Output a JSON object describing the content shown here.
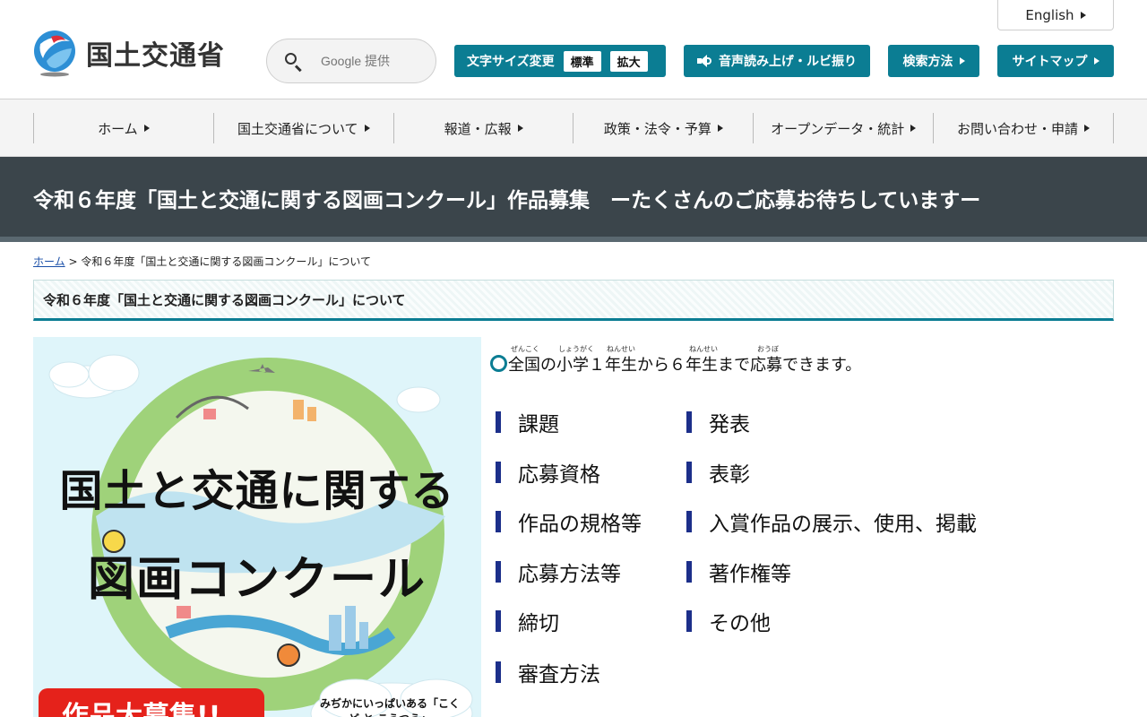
{
  "header": {
    "logo_text": "国土交通省",
    "english_label": "English",
    "search_placeholder": "Google 提供",
    "fontsize_label": "文字サイズ変更",
    "fontsize_standard": "標準",
    "fontsize_large": "拡大",
    "reader_label": "音声読み上げ・ルビ振り",
    "search_method_label": "検索方法",
    "sitemap_label": "サイトマップ"
  },
  "nav": {
    "items": [
      {
        "label": "ホーム"
      },
      {
        "label": "国土交通省について"
      },
      {
        "label": "報道・広報"
      },
      {
        "label": "政策・法令・予算"
      },
      {
        "label": "オープンデータ・統計"
      },
      {
        "label": "お問い合わせ・申請"
      }
    ]
  },
  "page": {
    "title": "令和６年度「国土と交通に関する図画コンクール」作品募集　ーたくさんのご応募お待ちしていますー",
    "breadcrumb_home": "ホーム",
    "breadcrumb_sep": ">",
    "breadcrumb_current": "令和６年度「国土と交通に関する図画コンクール」について",
    "section_heading": "令和６年度「国土と交通に関する図画コンクール」について"
  },
  "poster": {
    "title_line1": "国土と交通に関する",
    "title_line2": "図画コンクール",
    "badge": "作品大募集!!",
    "cloud_text": "みぢかにいっぱいある「こくど と こうつう」"
  },
  "content": {
    "eligibility": "全国の小学１年生から６年生まで応募できます。",
    "ruby": {
      "zenkoku": "ぜんこく",
      "shougaku": "しょうがく",
      "nensei1": "ねんせい",
      "nensei2": "ねんせい",
      "oubo": "おうぼ"
    },
    "left_links": [
      "課題",
      "応募資格",
      "作品の規格等",
      "応募方法等",
      "締切",
      "審査方法"
    ],
    "right_links": [
      "発表",
      "表彰",
      "入賞作品の展示、使用、掲載",
      "著作権等",
      "その他"
    ]
  },
  "colors": {
    "accent": "#0b7d93",
    "title_band": "#3b454b",
    "link_bar": "#1c2f8a",
    "badge_red": "#e5221b"
  }
}
